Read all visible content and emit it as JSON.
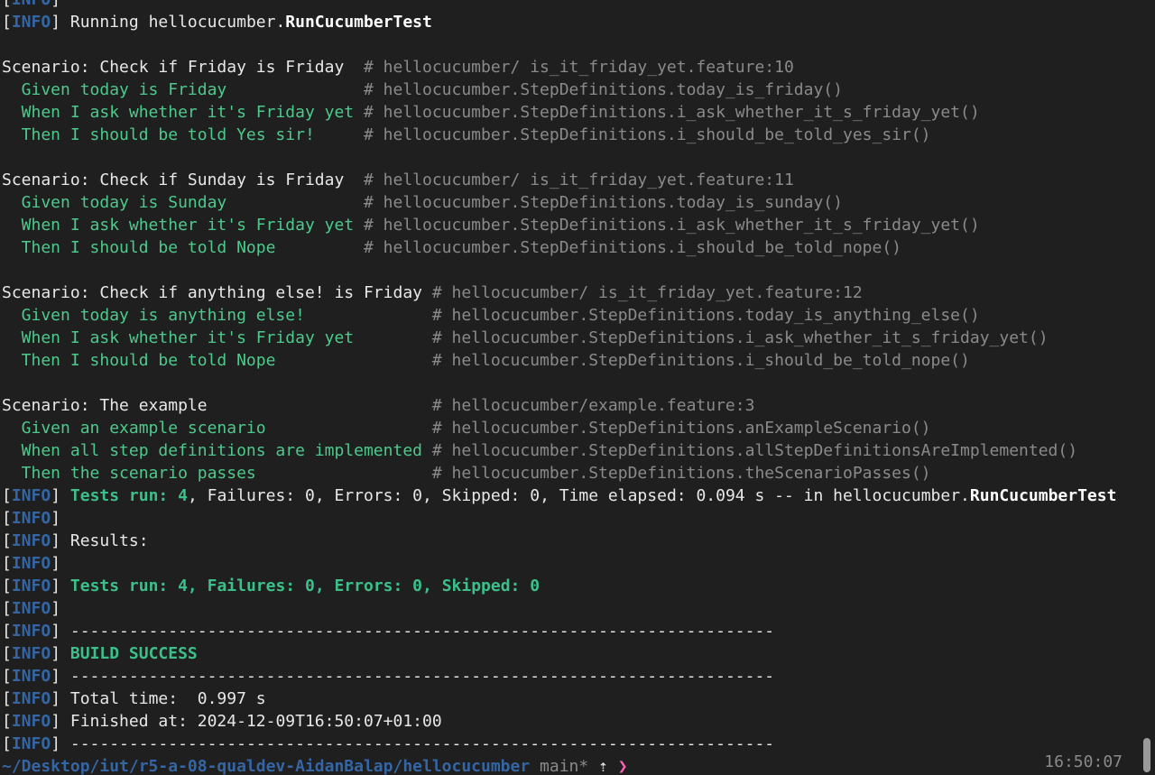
{
  "terminal": {
    "lines": [
      [
        {
          "t": "[",
          "c": "w"
        },
        {
          "t": "INFO",
          "c": "tag"
        },
        {
          "t": "]",
          "c": "w"
        }
      ],
      [
        {
          "t": "[",
          "c": "w"
        },
        {
          "t": "INFO",
          "c": "tag"
        },
        {
          "t": "] Running hellocucumber.",
          "c": "w"
        },
        {
          "t": "RunCucumberTest",
          "c": "b"
        }
      ],
      [],
      [
        {
          "t": "Scenario: Check if Friday is Friday  ",
          "c": "w"
        },
        {
          "t": "# hellocucumber/ is_it_friday_yet.feature:10",
          "c": "c"
        }
      ],
      [
        {
          "t": "  Given today is Friday              ",
          "c": "g"
        },
        {
          "t": "# hellocucumber.StepDefinitions.today_is_friday()",
          "c": "c"
        }
      ],
      [
        {
          "t": "  When I ask whether it's Friday yet ",
          "c": "g"
        },
        {
          "t": "# hellocucumber.StepDefinitions.i_ask_whether_it_s_friday_yet()",
          "c": "c"
        }
      ],
      [
        {
          "t": "  Then I should be told Yes sir!     ",
          "c": "g"
        },
        {
          "t": "# hellocucumber.StepDefinitions.i_should_be_told_yes_sir()",
          "c": "c"
        }
      ],
      [],
      [
        {
          "t": "Scenario: Check if Sunday is Friday  ",
          "c": "w"
        },
        {
          "t": "# hellocucumber/ is_it_friday_yet.feature:11",
          "c": "c"
        }
      ],
      [
        {
          "t": "  Given today is Sunday              ",
          "c": "g"
        },
        {
          "t": "# hellocucumber.StepDefinitions.today_is_sunday()",
          "c": "c"
        }
      ],
      [
        {
          "t": "  When I ask whether it's Friday yet ",
          "c": "g"
        },
        {
          "t": "# hellocucumber.StepDefinitions.i_ask_whether_it_s_friday_yet()",
          "c": "c"
        }
      ],
      [
        {
          "t": "  Then I should be told Nope         ",
          "c": "g"
        },
        {
          "t": "# hellocucumber.StepDefinitions.i_should_be_told_nope()",
          "c": "c"
        }
      ],
      [],
      [
        {
          "t": "Scenario: Check if anything else! is Friday ",
          "c": "w"
        },
        {
          "t": "# hellocucumber/ is_it_friday_yet.feature:12",
          "c": "c"
        }
      ],
      [
        {
          "t": "  Given today is anything else!             ",
          "c": "g"
        },
        {
          "t": "# hellocucumber.StepDefinitions.today_is_anything_else()",
          "c": "c"
        }
      ],
      [
        {
          "t": "  When I ask whether it's Friday yet        ",
          "c": "g"
        },
        {
          "t": "# hellocucumber.StepDefinitions.i_ask_whether_it_s_friday_yet()",
          "c": "c"
        }
      ],
      [
        {
          "t": "  Then I should be told Nope                ",
          "c": "g"
        },
        {
          "t": "# hellocucumber.StepDefinitions.i_should_be_told_nope()",
          "c": "c"
        }
      ],
      [],
      [
        {
          "t": "Scenario: The example                       ",
          "c": "w"
        },
        {
          "t": "# hellocucumber/example.feature:3",
          "c": "c"
        }
      ],
      [
        {
          "t": "  Given an example scenario                 ",
          "c": "g"
        },
        {
          "t": "# hellocucumber.StepDefinitions.anExampleScenario()",
          "c": "c"
        }
      ],
      [
        {
          "t": "  When all step definitions are implemented ",
          "c": "g"
        },
        {
          "t": "# hellocucumber.StepDefinitions.allStepDefinitionsAreImplemented()",
          "c": "c"
        }
      ],
      [
        {
          "t": "  Then the scenario passes                  ",
          "c": "g"
        },
        {
          "t": "# hellocucumber.StepDefinitions.theScenarioPasses()",
          "c": "c"
        }
      ],
      [
        {
          "t": "[",
          "c": "w"
        },
        {
          "t": "INFO",
          "c": "tag"
        },
        {
          "t": "] ",
          "c": "w"
        },
        {
          "t": "Tests run: 4",
          "c": "gb"
        },
        {
          "t": ", Failures: 0, Errors: 0, Skipped: 0, Time elapsed: 0.094 s -- in hellocucumber.",
          "c": "w"
        },
        {
          "t": "RunCucumberTest",
          "c": "b"
        }
      ],
      [
        {
          "t": "[",
          "c": "w"
        },
        {
          "t": "INFO",
          "c": "tag"
        },
        {
          "t": "]",
          "c": "w"
        }
      ],
      [
        {
          "t": "[",
          "c": "w"
        },
        {
          "t": "INFO",
          "c": "tag"
        },
        {
          "t": "] Results:",
          "c": "w"
        }
      ],
      [
        {
          "t": "[",
          "c": "w"
        },
        {
          "t": "INFO",
          "c": "tag"
        },
        {
          "t": "]",
          "c": "w"
        }
      ],
      [
        {
          "t": "[",
          "c": "w"
        },
        {
          "t": "INFO",
          "c": "tag"
        },
        {
          "t": "] ",
          "c": "w"
        },
        {
          "t": "Tests run: 4, Failures: 0, Errors: 0, Skipped: 0",
          "c": "gb"
        }
      ],
      [
        {
          "t": "[",
          "c": "w"
        },
        {
          "t": "INFO",
          "c": "tag"
        },
        {
          "t": "]",
          "c": "w"
        }
      ],
      [
        {
          "t": "[",
          "c": "w"
        },
        {
          "t": "INFO",
          "c": "tag"
        },
        {
          "t": "] ------------------------------------------------------------------------",
          "c": "w"
        }
      ],
      [
        {
          "t": "[",
          "c": "w"
        },
        {
          "t": "INFO",
          "c": "tag"
        },
        {
          "t": "] ",
          "c": "w"
        },
        {
          "t": "BUILD SUCCESS",
          "c": "gb"
        }
      ],
      [
        {
          "t": "[",
          "c": "w"
        },
        {
          "t": "INFO",
          "c": "tag"
        },
        {
          "t": "] ------------------------------------------------------------------------",
          "c": "w"
        }
      ],
      [
        {
          "t": "[",
          "c": "w"
        },
        {
          "t": "INFO",
          "c": "tag"
        },
        {
          "t": "] Total time:  0.997 s",
          "c": "w"
        }
      ],
      [
        {
          "t": "[",
          "c": "w"
        },
        {
          "t": "INFO",
          "c": "tag"
        },
        {
          "t": "] Finished at: 2024-12-09T16:50:07+01:00",
          "c": "w"
        }
      ],
      [
        {
          "t": "[",
          "c": "w"
        },
        {
          "t": "INFO",
          "c": "tag"
        },
        {
          "t": "] ------------------------------------------------------------------------",
          "c": "w"
        }
      ],
      [
        {
          "t": "~/Desktop/iut/r5-a-08-qualdev-AidanBalap/hellocucumber",
          "c": "tag"
        },
        {
          "t": " main* ",
          "c": "c"
        },
        {
          "t": "⇡ ",
          "c": "w"
        },
        {
          "t": "❯",
          "c": "m"
        }
      ]
    ]
  },
  "prompt": {
    "time": "16:50:07"
  },
  "colors": {
    "background": "#1f1f1f",
    "info_tag": "#3465a4",
    "step_green": "#4ec98c",
    "success_green": "#3cc08a",
    "comment_gray": "#8a8a8a",
    "prompt_arrow": "#ff5fb0"
  }
}
